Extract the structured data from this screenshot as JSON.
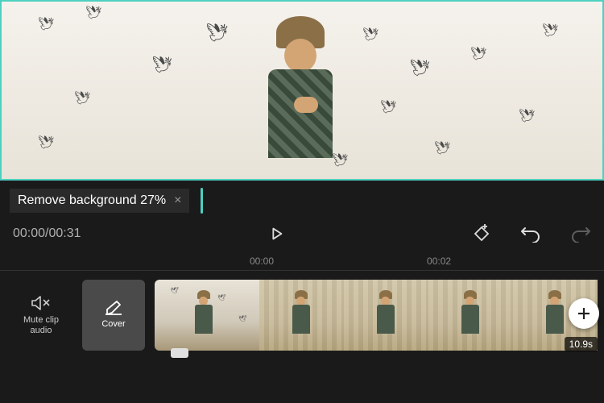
{
  "status": {
    "text": "Remove background 27%",
    "close": "×"
  },
  "timecode": {
    "current": "00:00",
    "total": "00:31",
    "separator": "/"
  },
  "ruler": {
    "t0": "00:00",
    "t1": "00:02"
  },
  "toolbar": {
    "mute": {
      "label": "Mute clip\naudio"
    },
    "cover": {
      "label": "Cover"
    }
  },
  "clip": {
    "duration": "10.9s"
  },
  "icons": {
    "play": "play-icon",
    "keyframe": "keyframe-icon",
    "undo": "undo-icon",
    "redo": "redo-icon",
    "mute": "mute-icon",
    "cover": "cover-edit-icon",
    "add": "+"
  },
  "colors": {
    "accent": "#4dd0c0"
  }
}
